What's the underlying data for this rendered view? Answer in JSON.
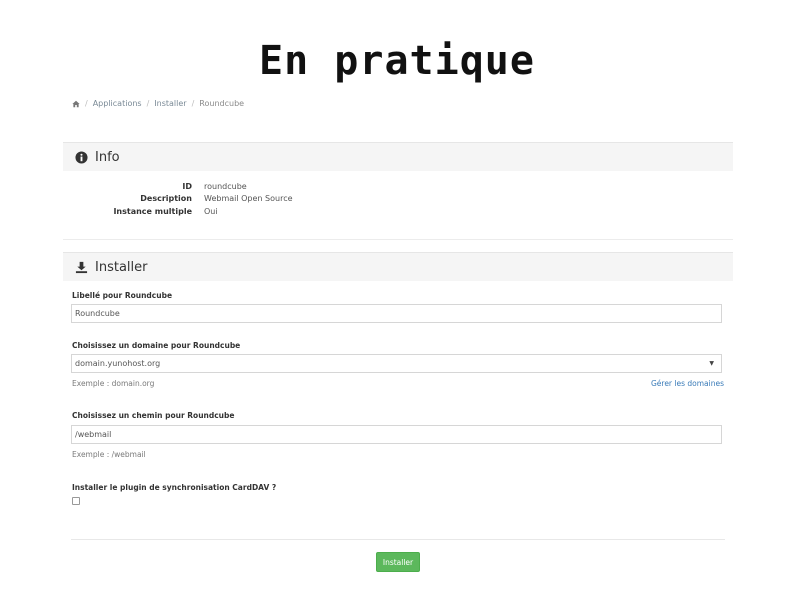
{
  "slide": {
    "title": "En pratique"
  },
  "breadcrumb": {
    "home_icon": "home-icon",
    "items": [
      "Applications",
      "Installer",
      "Roundcube"
    ]
  },
  "info_panel": {
    "icon": "info-circle-icon",
    "title": "Info",
    "rows": [
      {
        "key": "ID",
        "value": "roundcube"
      },
      {
        "key": "Description",
        "value": "Webmail Open Source"
      },
      {
        "key": "Instance multiple",
        "value": "Oui"
      }
    ]
  },
  "install_panel": {
    "icon": "download-icon",
    "title": "Installer",
    "label_field": {
      "label": "Libellé pour Roundcube",
      "value": "Roundcube"
    },
    "domain_field": {
      "label": "Choisissez un domaine pour Roundcube",
      "value": "domain.yunohost.org",
      "help": "Exemple : domain.org",
      "manage_link": "Gérer les domaines"
    },
    "path_field": {
      "label": "Choisissez un chemin pour Roundcube",
      "value": "/webmail",
      "help": "Exemple : /webmail"
    },
    "carddav_field": {
      "label": "Installer le plugin de synchronisation CardDAV ?",
      "checked": false
    },
    "submit_label": "Installer"
  },
  "colors": {
    "accent_green": "#5cb85c",
    "link_blue": "#3a7bb8",
    "panel_head_bg": "#f5f5f5"
  }
}
